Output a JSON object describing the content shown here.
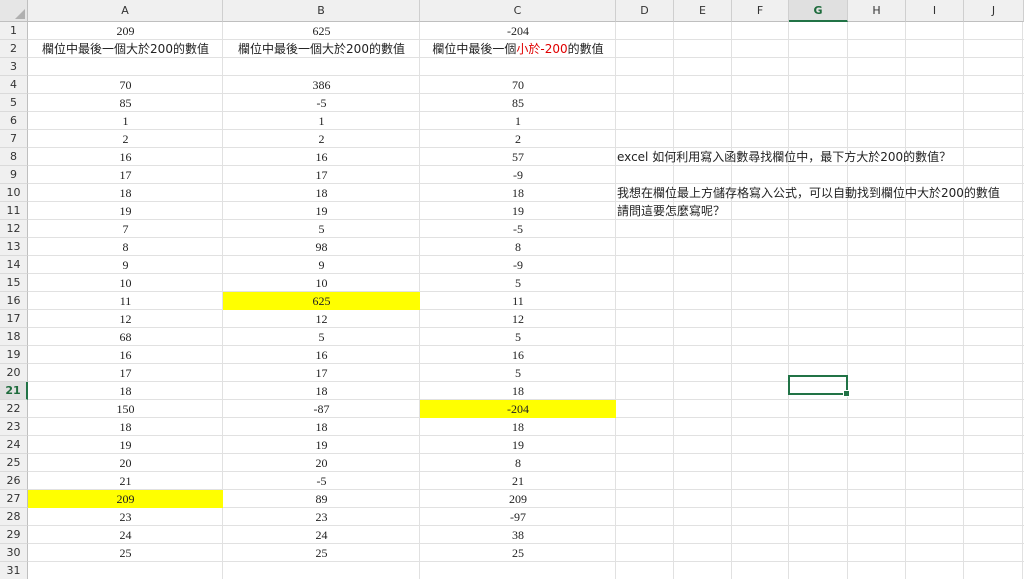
{
  "columns": [
    "A",
    "B",
    "C",
    "D",
    "E",
    "F",
    "G",
    "H",
    "I",
    "J"
  ],
  "selected_column": "G",
  "selected_row": "21",
  "row_numbers": [
    "1",
    "2",
    "3",
    "4",
    "5",
    "6",
    "7",
    "8",
    "9",
    "10",
    "11",
    "12",
    "13",
    "14",
    "15",
    "16",
    "17",
    "18",
    "19",
    "20",
    "21",
    "22",
    "23",
    "24",
    "25",
    "26",
    "27",
    "28",
    "29",
    "30",
    "31"
  ],
  "row1": {
    "a": "209",
    "b": "625",
    "c": "-204"
  },
  "row2": {
    "a": "欄位中最後一個大於200的數值",
    "b": "欄位中最後一個大於200的數值",
    "c_prefix": "欄位中最後一個",
    "c_red": "小於-200",
    "c_suffix": "的數值"
  },
  "data_rows": [
    [
      "70",
      "386",
      "70"
    ],
    [
      "85",
      "-5",
      "85"
    ],
    [
      "1",
      "1",
      "1"
    ],
    [
      "2",
      "2",
      "2"
    ],
    [
      "16",
      "16",
      "57"
    ],
    [
      "17",
      "17",
      "-9"
    ],
    [
      "18",
      "18",
      "18"
    ],
    [
      "19",
      "19",
      "19"
    ],
    [
      "7",
      "5",
      "-5"
    ],
    [
      "8",
      "98",
      "8"
    ],
    [
      "9",
      "9",
      "-9"
    ],
    [
      "10",
      "10",
      "5"
    ],
    [
      "11",
      "625",
      "11"
    ],
    [
      "12",
      "12",
      "12"
    ],
    [
      "68",
      "5",
      "5"
    ],
    [
      "16",
      "16",
      "16"
    ],
    [
      "17",
      "17",
      "5"
    ],
    [
      "18",
      "18",
      "18"
    ],
    [
      "150",
      "-87",
      "-204"
    ],
    [
      "18",
      "18",
      "18"
    ],
    [
      "19",
      "19",
      "19"
    ],
    [
      "20",
      "20",
      "8"
    ],
    [
      "21",
      "-5",
      "21"
    ],
    [
      "209",
      "89",
      "209"
    ],
    [
      "23",
      "23",
      "-97"
    ],
    [
      "24",
      "24",
      "38"
    ],
    [
      "25",
      "25",
      "25"
    ]
  ],
  "highlight_color": "#ffff00",
  "notes": {
    "line1": "excel 如何利用寫入函數尋找欄位中，最下方大於200的數值？",
    "line2": "我想在欄位最上方儲存格寫入公式，可以自動找到欄位中大於200的數值",
    "line3": "請問這要怎麼寫呢？"
  }
}
